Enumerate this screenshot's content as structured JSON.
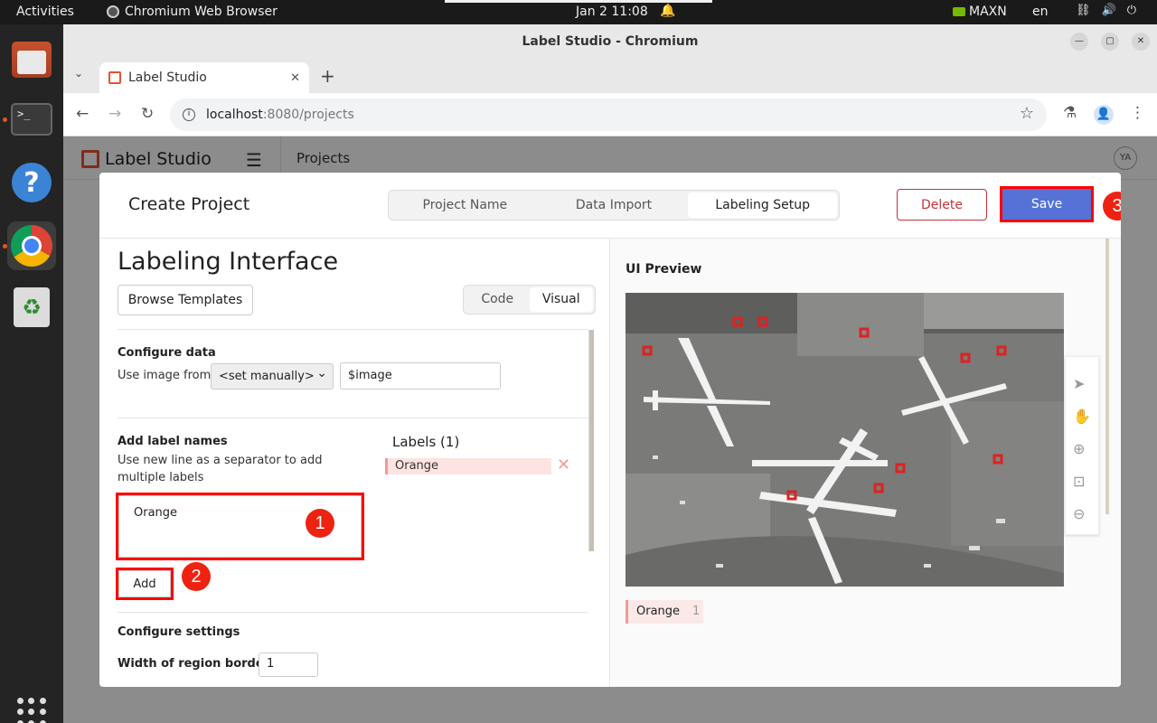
{
  "topbar": {
    "activities": "Activities",
    "app_name": "Chromium Web Browser",
    "clock": "Jan 2  11:08",
    "gpu_mode": "MAXN",
    "language": "en"
  },
  "dock": {
    "items": [
      "files-icon",
      "terminal-icon",
      "help-icon",
      "chromium-icon",
      "trash-icon",
      "app-grid-icon"
    ]
  },
  "browser": {
    "window_title": "Label Studio - Chromium",
    "tab_title": "Label Studio",
    "url_host": "localhost",
    "url_path": ":8080/projects"
  },
  "app": {
    "logo_text": "Label Studio",
    "breadcrumb": "Projects",
    "avatar_initials": "YA"
  },
  "modal": {
    "title": "Create Project",
    "steps": [
      "Project Name",
      "Data Import",
      "Labeling Setup"
    ],
    "active_step": "Labeling Setup",
    "delete_label": "Delete",
    "save_label": "Save"
  },
  "labeling": {
    "heading": "Labeling Interface",
    "browse_label": "Browse Templates",
    "mode_code": "Code",
    "mode_visual": "Visual",
    "configure_data_title": "Configure data",
    "use_image_from": "Use image from",
    "source_select": "<set manually>",
    "source_value": "$image",
    "add_label_title": "Add label names",
    "add_label_hint": "Use new line as a separator to add multiple labels",
    "textarea_value": "Orange",
    "add_button": "Add",
    "labels_title": "Labels (1)",
    "labels": [
      "Orange"
    ],
    "configure_settings_title": "Configure settings",
    "region_border_label": "Width of region borders",
    "region_border_value": "1"
  },
  "preview": {
    "title": "UI Preview",
    "label_chip": "Orange",
    "label_chip_hotkey": "1"
  },
  "annotations": {
    "step1": "1",
    "step2": "2",
    "step3": "3"
  },
  "colors": {
    "save_button": "#5672d6",
    "delete_border": "#c5323a",
    "highlight_box": "#ff0000",
    "label_orange_bg": "#fde3e1"
  }
}
